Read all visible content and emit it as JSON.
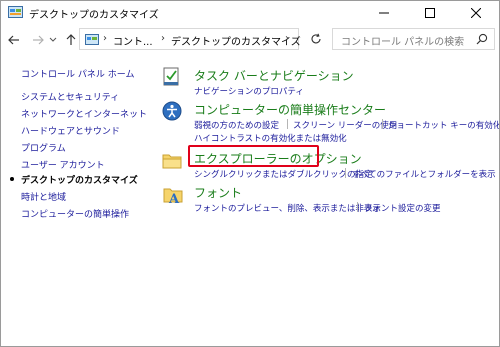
{
  "window": {
    "title": "デスクトップのカスタマイズ"
  },
  "nav": {
    "breadcrumb": [
      "コント...",
      "デスクトップのカスタマイズ"
    ],
    "search_placeholder": "コントロール パネルの検索"
  },
  "sidebar": {
    "items": [
      {
        "label": "コントロール パネル ホーム"
      },
      {
        "label": "システムとセキュリティ"
      },
      {
        "label": "ネットワークとインターネット"
      },
      {
        "label": "ハードウェアとサウンド"
      },
      {
        "label": "プログラム"
      },
      {
        "label": "ユーザー アカウント"
      },
      {
        "label": "デスクトップのカスタマイズ",
        "current": true
      },
      {
        "label": "時計と地域"
      },
      {
        "label": "コンピューターの簡単操作"
      }
    ]
  },
  "categories": [
    {
      "title": "タスク バーとナビゲーション",
      "links": [
        "ナビゲーションのプロパティ"
      ]
    },
    {
      "title": "コンピューターの簡単操作センター",
      "links": [
        "弱視の方のための設定",
        "スクリーン リーダーの使用",
        "ショートカット キーの有効化",
        "ハイコントラストの有効化または無効化"
      ]
    },
    {
      "title": "エクスプローラーのオプション",
      "links": [
        "シングルクリックまたはダブルクリックの指定",
        "すべてのファイルとフォルダーを表示"
      ]
    },
    {
      "title": "フォント",
      "links": [
        "フォントのプレビュー、削除、表示または非表示",
        "フォント設定の変更"
      ]
    }
  ],
  "colors": {
    "category_title": "#1a7d1a",
    "link": "#1b1b9b",
    "highlight": "#e0001a"
  }
}
